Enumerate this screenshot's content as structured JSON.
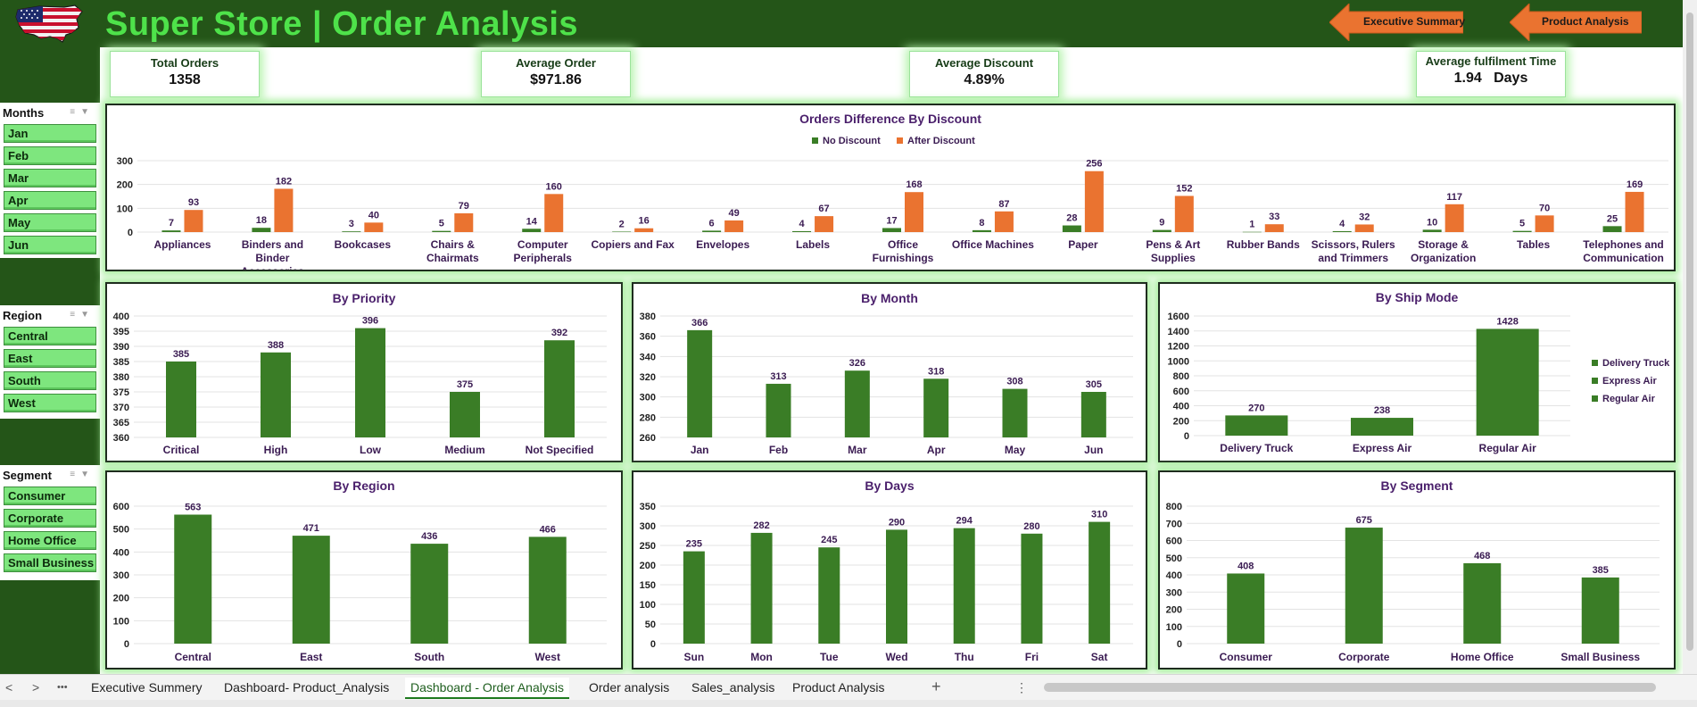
{
  "header": {
    "title": "Super Store | Order Analysis",
    "nav": [
      {
        "label": "Executive Summary"
      },
      {
        "label": "Product Analysis"
      }
    ]
  },
  "slicers": {
    "months": {
      "title": "Months",
      "items": [
        "Jan",
        "Feb",
        "Mar",
        "Apr",
        "May",
        "Jun"
      ]
    },
    "region": {
      "title": "Region",
      "items": [
        "Central",
        "East",
        "South",
        "West"
      ]
    },
    "segment": {
      "title": "Segment",
      "items": [
        "Consumer",
        "Corporate",
        "Home Office",
        "Small Business"
      ]
    }
  },
  "kpis": [
    {
      "label": "Total Orders",
      "value": "1358"
    },
    {
      "label": "Average Order",
      "value": "$971.86"
    },
    {
      "label": "Average Discount",
      "value": "4.89%"
    },
    {
      "label": "Average fulfilment Time",
      "value": "1.94   Days"
    }
  ],
  "colors": {
    "bar_green": "#3a7d26",
    "bar_orange": "#ea7330",
    "header_bg": "#245518",
    "title_green": "#4ee24a",
    "chart_title": "#4a1f6b",
    "nav_orange": "#ea7330"
  },
  "chart_data": [
    {
      "id": "discount",
      "type": "bar",
      "title": "Orders Difference By Discount",
      "categories": [
        "Appliances",
        "Binders and Binder Accessories",
        "Bookcases",
        "Chairs & Chairmats",
        "Computer Peripherals",
        "Copiers and Fax",
        "Envelopes",
        "Labels",
        "Office Furnishings",
        "Office Machines",
        "Paper",
        "Pens & Art Supplies",
        "Rubber Bands",
        "Scissors, Rulers and Trimmers",
        "Storage & Organization",
        "Tables",
        "Telephones and Communication"
      ],
      "series": [
        {
          "name": "No Discount",
          "values": [
            7,
            18,
            3,
            5,
            14,
            2,
            6,
            4,
            17,
            8,
            28,
            9,
            1,
            4,
            10,
            5,
            25
          ]
        },
        {
          "name": "After Discount",
          "values": [
            93,
            182,
            40,
            79,
            160,
            16,
            49,
            67,
            168,
            87,
            256,
            152,
            33,
            32,
            117,
            70,
            169
          ]
        }
      ],
      "yticks": [
        0,
        100,
        200,
        300
      ],
      "ylim": [
        0,
        300
      ],
      "legend": "top"
    },
    {
      "id": "priority",
      "type": "bar",
      "title": "By Priority",
      "categories": [
        "Critical",
        "High",
        "Low",
        "Medium",
        "Not Specified"
      ],
      "values": [
        385,
        388,
        396,
        375,
        392
      ],
      "yticks": [
        360,
        365,
        370,
        375,
        380,
        385,
        390,
        395,
        400
      ],
      "ylim": [
        360,
        400
      ]
    },
    {
      "id": "month",
      "type": "bar",
      "title": "By Month",
      "categories": [
        "Jan",
        "Feb",
        "Mar",
        "Apr",
        "May",
        "Jun"
      ],
      "values": [
        366,
        313,
        326,
        318,
        308,
        305
      ],
      "yticks": [
        260,
        280,
        300,
        320,
        340,
        360,
        380
      ],
      "ylim": [
        260,
        380
      ]
    },
    {
      "id": "shipmode",
      "type": "bar",
      "title": "By Ship Mode",
      "categories": [
        "Delivery Truck",
        "Express Air",
        "Regular Air"
      ],
      "values": [
        270,
        238,
        1428
      ],
      "yticks": [
        0,
        200,
        400,
        600,
        800,
        1000,
        1200,
        1400,
        1600
      ],
      "ylim": [
        0,
        1600
      ],
      "legend": "right"
    },
    {
      "id": "region",
      "type": "bar",
      "title": "By Region",
      "categories": [
        "Central",
        "East",
        "South",
        "West"
      ],
      "values": [
        563,
        471,
        436,
        466
      ],
      "yticks": [
        0,
        100,
        200,
        300,
        400,
        500,
        600
      ],
      "ylim": [
        0,
        600
      ]
    },
    {
      "id": "days",
      "type": "bar",
      "title": "By Days",
      "categories": [
        "Sun",
        "Mon",
        "Tue",
        "Wed",
        "Thu",
        "Fri",
        "Sat"
      ],
      "values": [
        235,
        282,
        245,
        290,
        294,
        280,
        310
      ],
      "yticks": [
        0,
        50,
        100,
        150,
        200,
        250,
        300,
        350
      ],
      "ylim": [
        0,
        350
      ]
    },
    {
      "id": "segment",
      "type": "bar",
      "title": "By Segment",
      "categories": [
        "Consumer",
        "Corporate",
        "Home Office",
        "Small Business"
      ],
      "values": [
        408,
        675,
        468,
        385
      ],
      "yticks": [
        0,
        100,
        200,
        300,
        400,
        500,
        600,
        700,
        800
      ],
      "ylim": [
        0,
        800
      ]
    }
  ],
  "sheet_tabs": [
    {
      "label": "Executive Summery",
      "active": false
    },
    {
      "label": "Dashboard- Product_Analysis",
      "active": false
    },
    {
      "label": "Dashboard - Order Analysis",
      "active": true
    },
    {
      "label": "Order analysis",
      "active": false
    },
    {
      "label": "Sales_analysis",
      "active": false
    },
    {
      "label": "Product Analysis",
      "active": false
    }
  ],
  "tabbar": {
    "prev": "<",
    "next": ">",
    "more": "•••",
    "add": "+",
    "options": "⋮"
  }
}
